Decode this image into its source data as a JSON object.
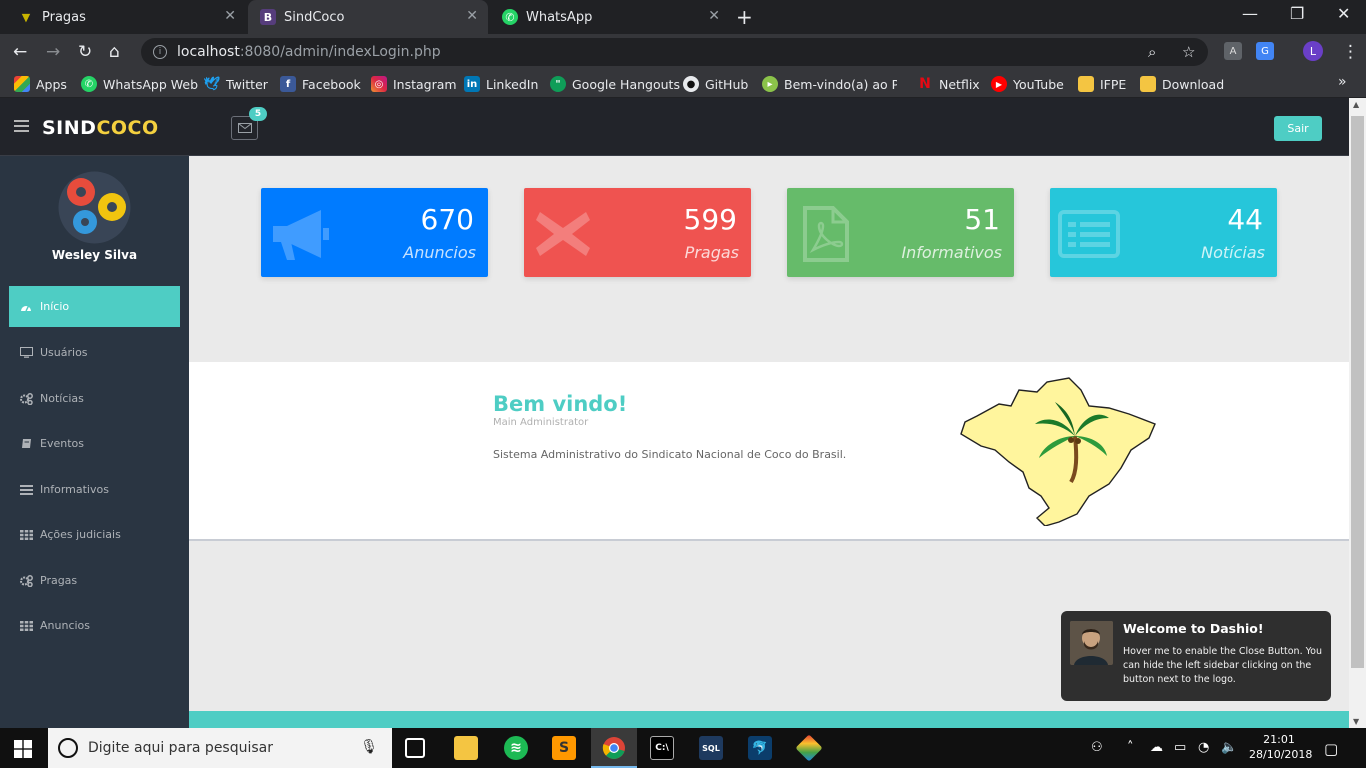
{
  "browser": {
    "tabs": [
      {
        "title": "Pragas",
        "icon": "pest-icon"
      },
      {
        "title": "SindCoco",
        "icon": "bootstrap-icon",
        "active": true
      },
      {
        "title": "WhatsApp",
        "icon": "whatsapp-icon"
      }
    ],
    "url_host": "localhost",
    "url_path": ":8080/admin/indexLogin.php",
    "profile_initial": "L",
    "bookmarks": [
      "Apps",
      "WhatsApp Web",
      "Twitter",
      "Facebook",
      "Instagram",
      "LinkedIn",
      "Google Hangouts",
      "GitHub",
      "Bem-vindo(a) ao Prim",
      "Netflix",
      "YouTube",
      "IFPE",
      "Download"
    ]
  },
  "header": {
    "logo_main": "SIND",
    "logo_accent": "COCO",
    "mail_badge": "5",
    "logout_label": "Sair"
  },
  "sidebar": {
    "username": "Wesley Silva",
    "items": [
      {
        "label": "Início",
        "icon": "dashboard-icon",
        "active": true
      },
      {
        "label": "Usuários",
        "icon": "monitor-icon"
      },
      {
        "label": "Notícias",
        "icon": "cogs-icon"
      },
      {
        "label": "Eventos",
        "icon": "book-icon"
      },
      {
        "label": "Informativos",
        "icon": "list-icon"
      },
      {
        "label": "Ações judiciais",
        "icon": "grid-icon"
      },
      {
        "label": "Pragas",
        "icon": "cogs-icon"
      },
      {
        "label": "Anuncios",
        "icon": "grid-icon"
      }
    ]
  },
  "stats": [
    {
      "value": "670",
      "label": "Anuncios",
      "color": "#007bff",
      "icon": "megaphone-icon"
    },
    {
      "value": "599",
      "label": "Pragas",
      "color": "#ef5350",
      "icon": "x-icon"
    },
    {
      "value": "51",
      "label": "Informativos",
      "color": "#66bb6a",
      "icon": "pdf-icon"
    },
    {
      "value": "44",
      "label": "Notícias",
      "color": "#26c6da",
      "icon": "newspaper-icon"
    }
  ],
  "welcome": {
    "title": "Bem vindo!",
    "subtitle": "Main Administrator",
    "text": "Sistema Administrativo do Sindicato Nacional de Coco do Brasil."
  },
  "toast": {
    "title": "Welcome to Dashio!",
    "body": "Hover me to enable the Close Button. You can hide the left sidebar clicking on the button next to the logo."
  },
  "taskbar": {
    "search_placeholder": "Digite aqui para pesquisar",
    "time": "21:01",
    "date": "28/10/2018"
  },
  "colors": {
    "accent": "#4ecdc4",
    "sidebar": "#2a3542",
    "header": "#22242a"
  }
}
